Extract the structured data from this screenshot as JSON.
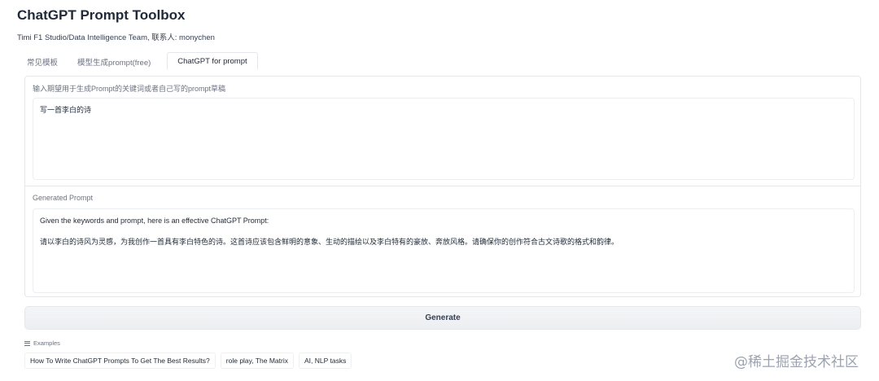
{
  "app": {
    "title": "ChatGPT Prompt Toolbox",
    "subtitle": "Timi F1 Studio/Data Intelligence Team, 联系人: monychen"
  },
  "tabs": [
    {
      "label": "常见模板",
      "active": false
    },
    {
      "label": "模型生成prompt(free)",
      "active": false
    },
    {
      "label": "ChatGPT for prompt",
      "active": true
    }
  ],
  "input_block": {
    "label": "输入期望用于生成Prompt的关键词或者自己写的prompt草稿",
    "value": "写一首李白的诗"
  },
  "output_block": {
    "label": "Generated Prompt",
    "line1": "Given the keywords and prompt, here is an effective ChatGPT Prompt:",
    "line2": "请以李白的诗风为灵感，为我创作一首具有李白特色的诗。这首诗应该包含鲜明的意象、生动的描绘以及李白特有的豪放、奔放风格。请确保你的创作符合古文诗歌的格式和韵律。"
  },
  "generate_button": {
    "label": "Generate"
  },
  "examples": {
    "label": "Examples",
    "items": [
      "How To Write ChatGPT Prompts To Get The Best Results?",
      "role play, The Matrix",
      "AI, NLP tasks"
    ]
  },
  "watermark": "@稀土掘金技术社区",
  "colors": {
    "text": "#1f2937",
    "muted": "#6b7280",
    "border": "#e5e7eb",
    "button_bg": "#eceef1"
  }
}
